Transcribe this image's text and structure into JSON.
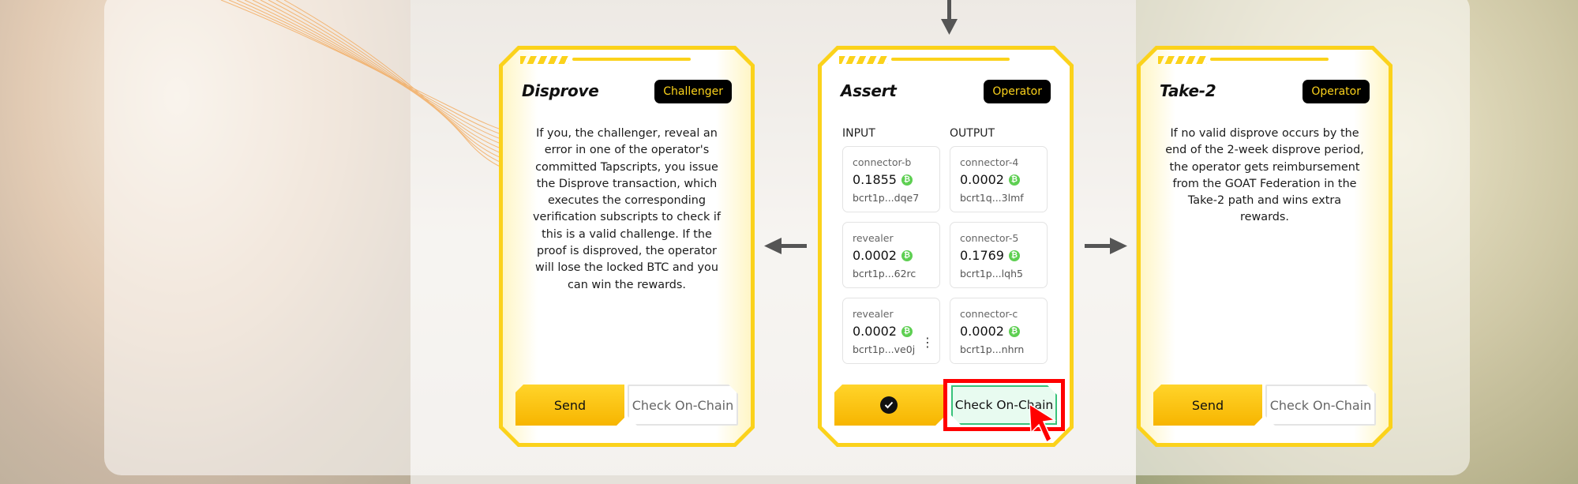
{
  "cards": {
    "disprove": {
      "title": "Disprove",
      "badge": "Challenger",
      "description": "If you, the challenger, reveal an error in one of the operator's committed Tapscripts, you issue the Disprove transaction, which executes the corresponding verification subscripts to check if this is a valid challenge. If the proof is disproved, the operator will lose the locked BTC and you can win the rewards.",
      "send_label": "Send",
      "check_label": "Check On-Chain"
    },
    "assert": {
      "title": "Assert",
      "badge": "Operator",
      "input_header": "INPUT",
      "output_header": "OUTPUT",
      "inputs": [
        {
          "name": "connector-b",
          "amount": "0.1855",
          "address": "bcrt1p...dqe7"
        },
        {
          "name": "revealer",
          "amount": "0.0002",
          "address": "bcrt1p...62rc"
        },
        {
          "name": "revealer",
          "amount": "0.0002",
          "address": "bcrt1p...ve0j"
        }
      ],
      "outputs": [
        {
          "name": "connector-4",
          "amount": "0.0002",
          "address": "bcrt1q...3lmf"
        },
        {
          "name": "connector-5",
          "amount": "0.1769",
          "address": "bcrt1p...lqh5"
        },
        {
          "name": "connector-c",
          "amount": "0.0002",
          "address": "bcrt1p...nhrn"
        }
      ],
      "more_glyph": "⋮",
      "btc_glyph": "₿",
      "check_label": "Check On-Chain"
    },
    "take2": {
      "title": "Take-2",
      "badge": "Operator",
      "description": "If no valid disprove occurs by the end of the 2-week disprove period, the operator gets reimbursement from the GOAT Federation in the Take-2 path and wins extra rewards.",
      "send_label": "Send",
      "check_label": "Check On-Chain"
    }
  },
  "colors": {
    "accent_yellow": "#fbd21b",
    "badge_bg": "#000000",
    "btc_green": "#5ecf52",
    "highlight_red": "#ff0000",
    "chain_green": "#38c27a"
  },
  "icons": [
    "arrow-down-icon",
    "arrow-left-icon",
    "arrow-right-icon",
    "check-circle-icon",
    "bitcoin-icon",
    "more-vertical-icon",
    "cursor-pointer-icon"
  ]
}
